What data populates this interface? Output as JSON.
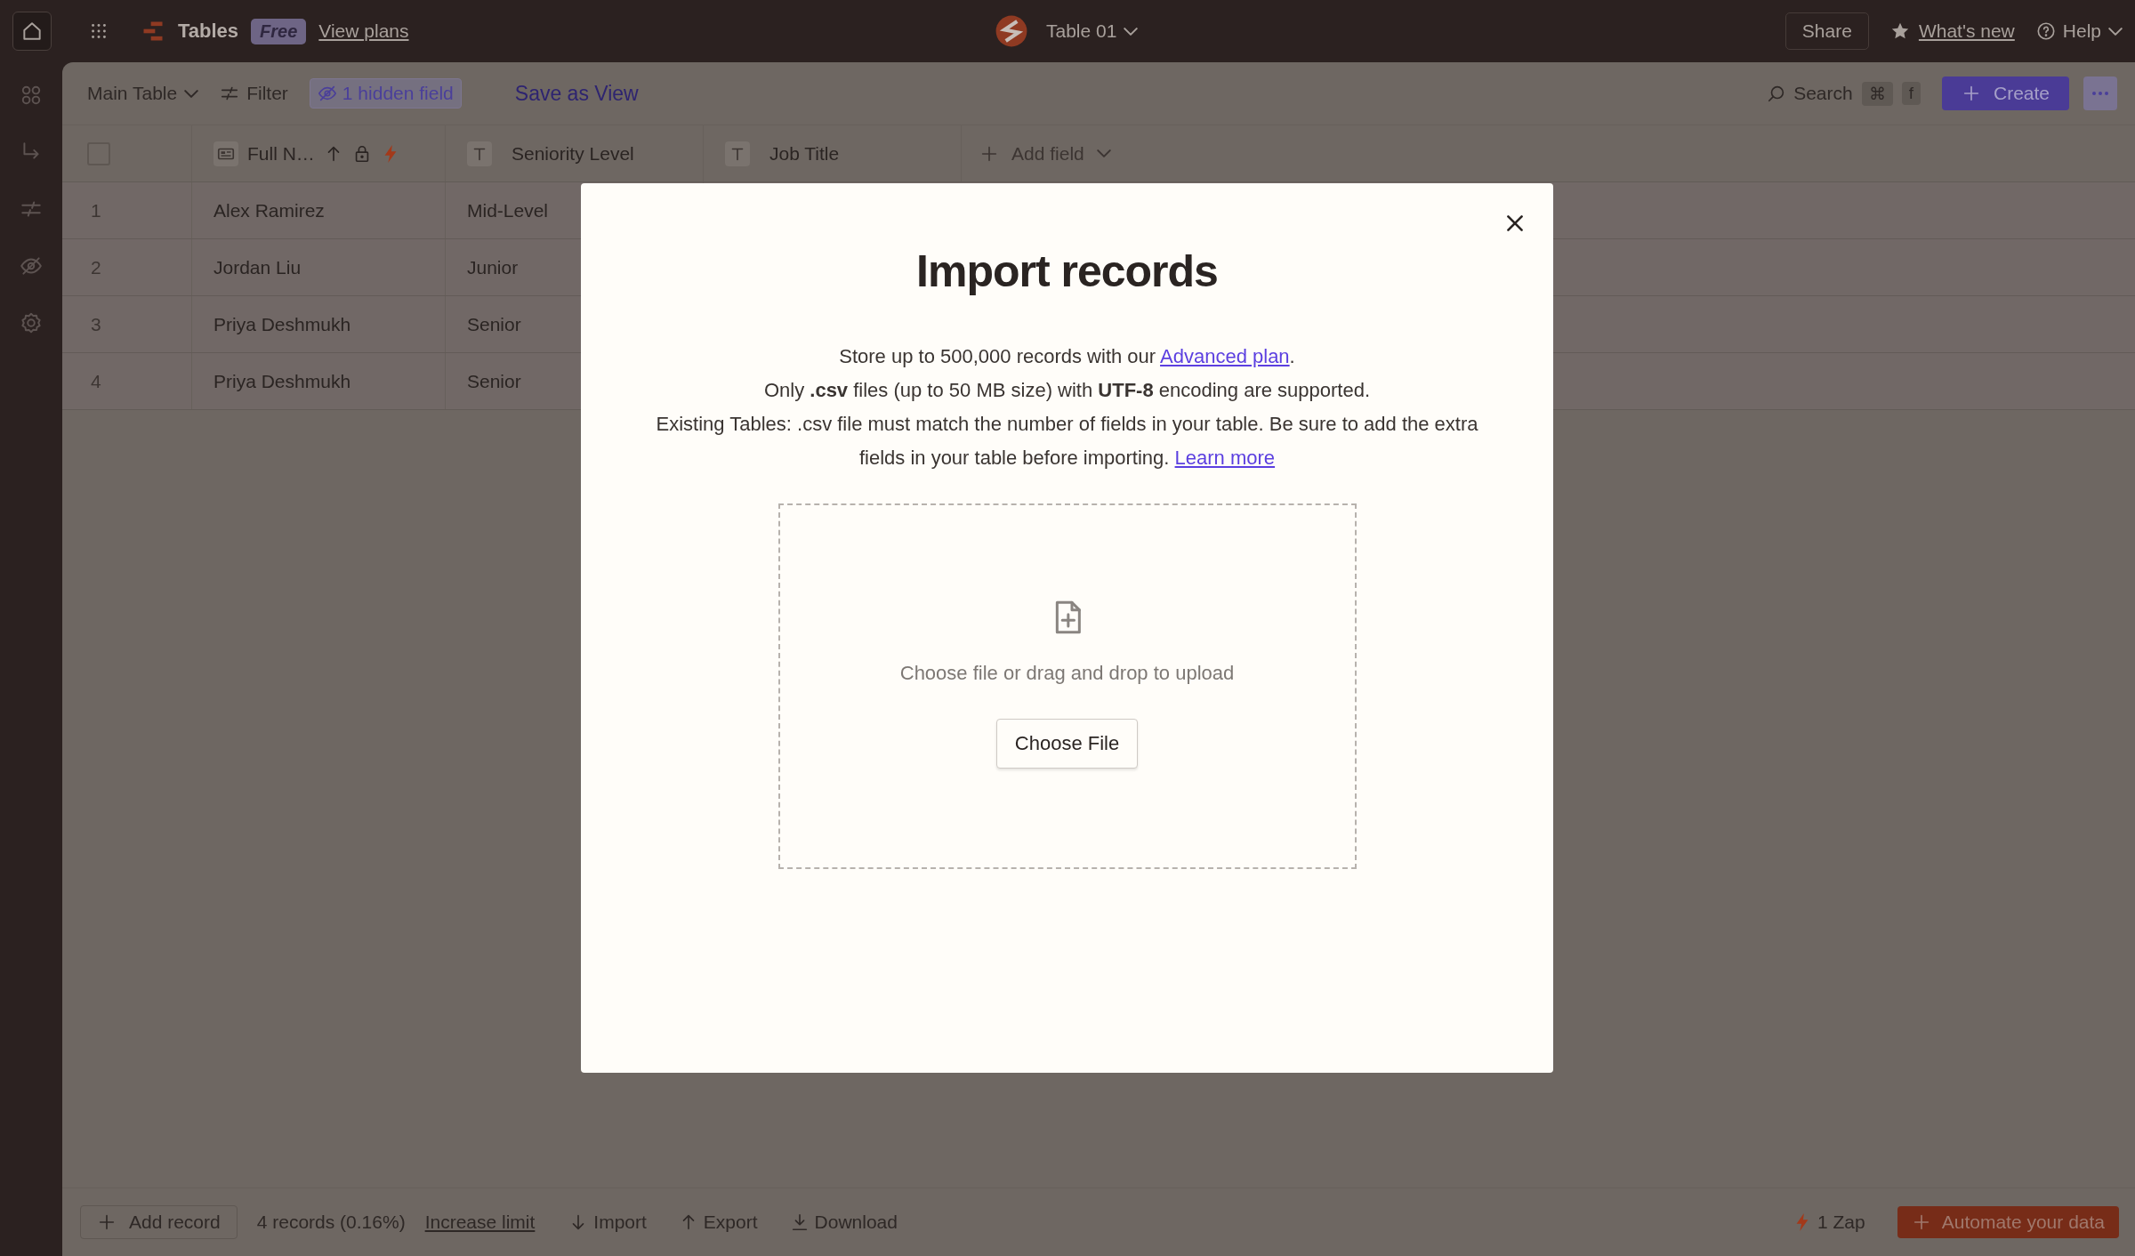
{
  "topbar": {
    "app_name": "Tables",
    "plan_badge": "Free",
    "plans_link": "View plans",
    "table_name": "Table 01",
    "share": "Share",
    "whats_new": "What's new",
    "help": "Help"
  },
  "toolbar": {
    "view": "Main Table",
    "filter": "Filter",
    "hidden_fields": "1 hidden field",
    "save_view": "Save as View",
    "search": "Search",
    "shortcut": [
      "⌘",
      "f"
    ],
    "create": "Create"
  },
  "table": {
    "select_all": {
      "checked": false
    },
    "columns": [
      {
        "label": "Full N…",
        "kind": "name"
      },
      {
        "label": "Seniority Level",
        "kind": "text"
      },
      {
        "label": "Job Title",
        "kind": "text"
      }
    ],
    "add_field": "Add field",
    "rows": [
      {
        "number": "1",
        "cells": [
          "Alex Ramirez",
          "Mid-Level"
        ]
      },
      {
        "number": "2",
        "cells": [
          "Jordan Liu",
          "Junior"
        ]
      },
      {
        "number": "3",
        "cells": [
          "Priya Deshmukh",
          "Senior"
        ]
      },
      {
        "number": "4",
        "cells": [
          "Priya Deshmukh",
          "Senior"
        ]
      }
    ]
  },
  "footer": {
    "add_record": "Add record",
    "count": "4 records (0.16%)",
    "increase_limit": "Increase limit",
    "actions": [
      {
        "label": "Import",
        "kind": "import"
      },
      {
        "label": "Export",
        "kind": "export"
      },
      {
        "label": "Download",
        "kind": "download"
      }
    ],
    "zaps": "1 Zap",
    "automate": "Automate your data"
  },
  "modal": {
    "title": "Import records",
    "paragraphs": [
      {
        "text": "Store up to 500,000 records with our ",
        "link": "Advanced plan",
        "after": "."
      },
      {
        "text": "Only **.csv** files (up to 50 MB size) with **UTF-8** encoding are supported."
      },
      {
        "text": "Existing Tables: .csv file must match the number of fields in your table. Be sure to add the extra fields in your table before importing. ",
        "link": "Learn more"
      }
    ],
    "dropzone": {
      "hint": "Choose file or drag and drop to upload",
      "button": "Choose File"
    }
  }
}
